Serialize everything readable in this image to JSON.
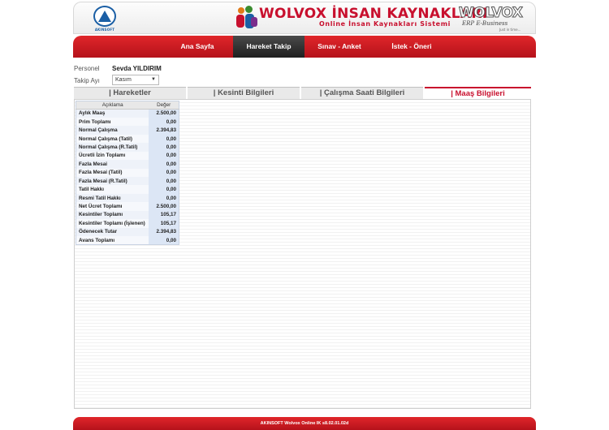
{
  "header": {
    "akinsoft_label": "AKINSOFT",
    "title": "WOLVOX İNSAN KAYNAKLARI",
    "subtitle": "Online İnsan Kaynakları Sistemi",
    "brand": "WOLVOX",
    "brand_tag": "ERP E-Business",
    "brand_slogan": "Just in time..."
  },
  "nav": {
    "items": [
      {
        "label": "Ana Sayfa"
      },
      {
        "label": "Hareket Takip"
      },
      {
        "label": "Sınav - Anket"
      },
      {
        "label": "İstek - Öneri"
      }
    ],
    "active_index": 1
  },
  "info": {
    "personel_label": "Personel",
    "personel_value": "Sevda YILDIRIM",
    "takip_label": "Takip Ayı",
    "takip_value": "Kasım"
  },
  "tabs": [
    {
      "label": "| Hareketler"
    },
    {
      "label": "| Kesinti Bilgileri"
    },
    {
      "label": "| Çalışma Saati Bilgileri"
    },
    {
      "label": "| Maaş Bilgileri"
    }
  ],
  "active_tab": 3,
  "table": {
    "headers": [
      "Açıklama",
      "Değer"
    ],
    "rows": [
      [
        "Aylık Maaş",
        "2.500,00"
      ],
      [
        "Prim Toplamı",
        "0,00"
      ],
      [
        "Normal Çalışma",
        "2.394,83"
      ],
      [
        "Normal Çalışma (Tatil)",
        "0,00"
      ],
      [
        "Normal Çalışma (R.Tatil)",
        "0,00"
      ],
      [
        "Ücretli İzin Toplamı",
        "0,00"
      ],
      [
        "Fazla Mesai",
        "0,00"
      ],
      [
        "Fazla Mesai (Tatil)",
        "0,00"
      ],
      [
        "Fazla Mesai (R.Tatil)",
        "0,00"
      ],
      [
        "Tatil Hakkı",
        "0,00"
      ],
      [
        "Resmi Tatil Hakkı",
        "0,00"
      ],
      [
        "Net Ücret Toplamı",
        "2.500,00"
      ],
      [
        "Kesintiler Toplamı",
        "105,17"
      ],
      [
        "Kesintiler Toplamı (İşlenen)",
        "105,17"
      ],
      [
        "Ödenecek Tutar",
        "2.394,83"
      ],
      [
        "Avans Toplamı",
        "0,00"
      ]
    ]
  },
  "footer": {
    "text": "AKINSOFT Wolvox Online IK s8.02.01.02d"
  },
  "colors": {
    "brand_red": "#c8102e",
    "nav_active": "#2a2a2a",
    "table_value_bg": "#dce6f5"
  }
}
